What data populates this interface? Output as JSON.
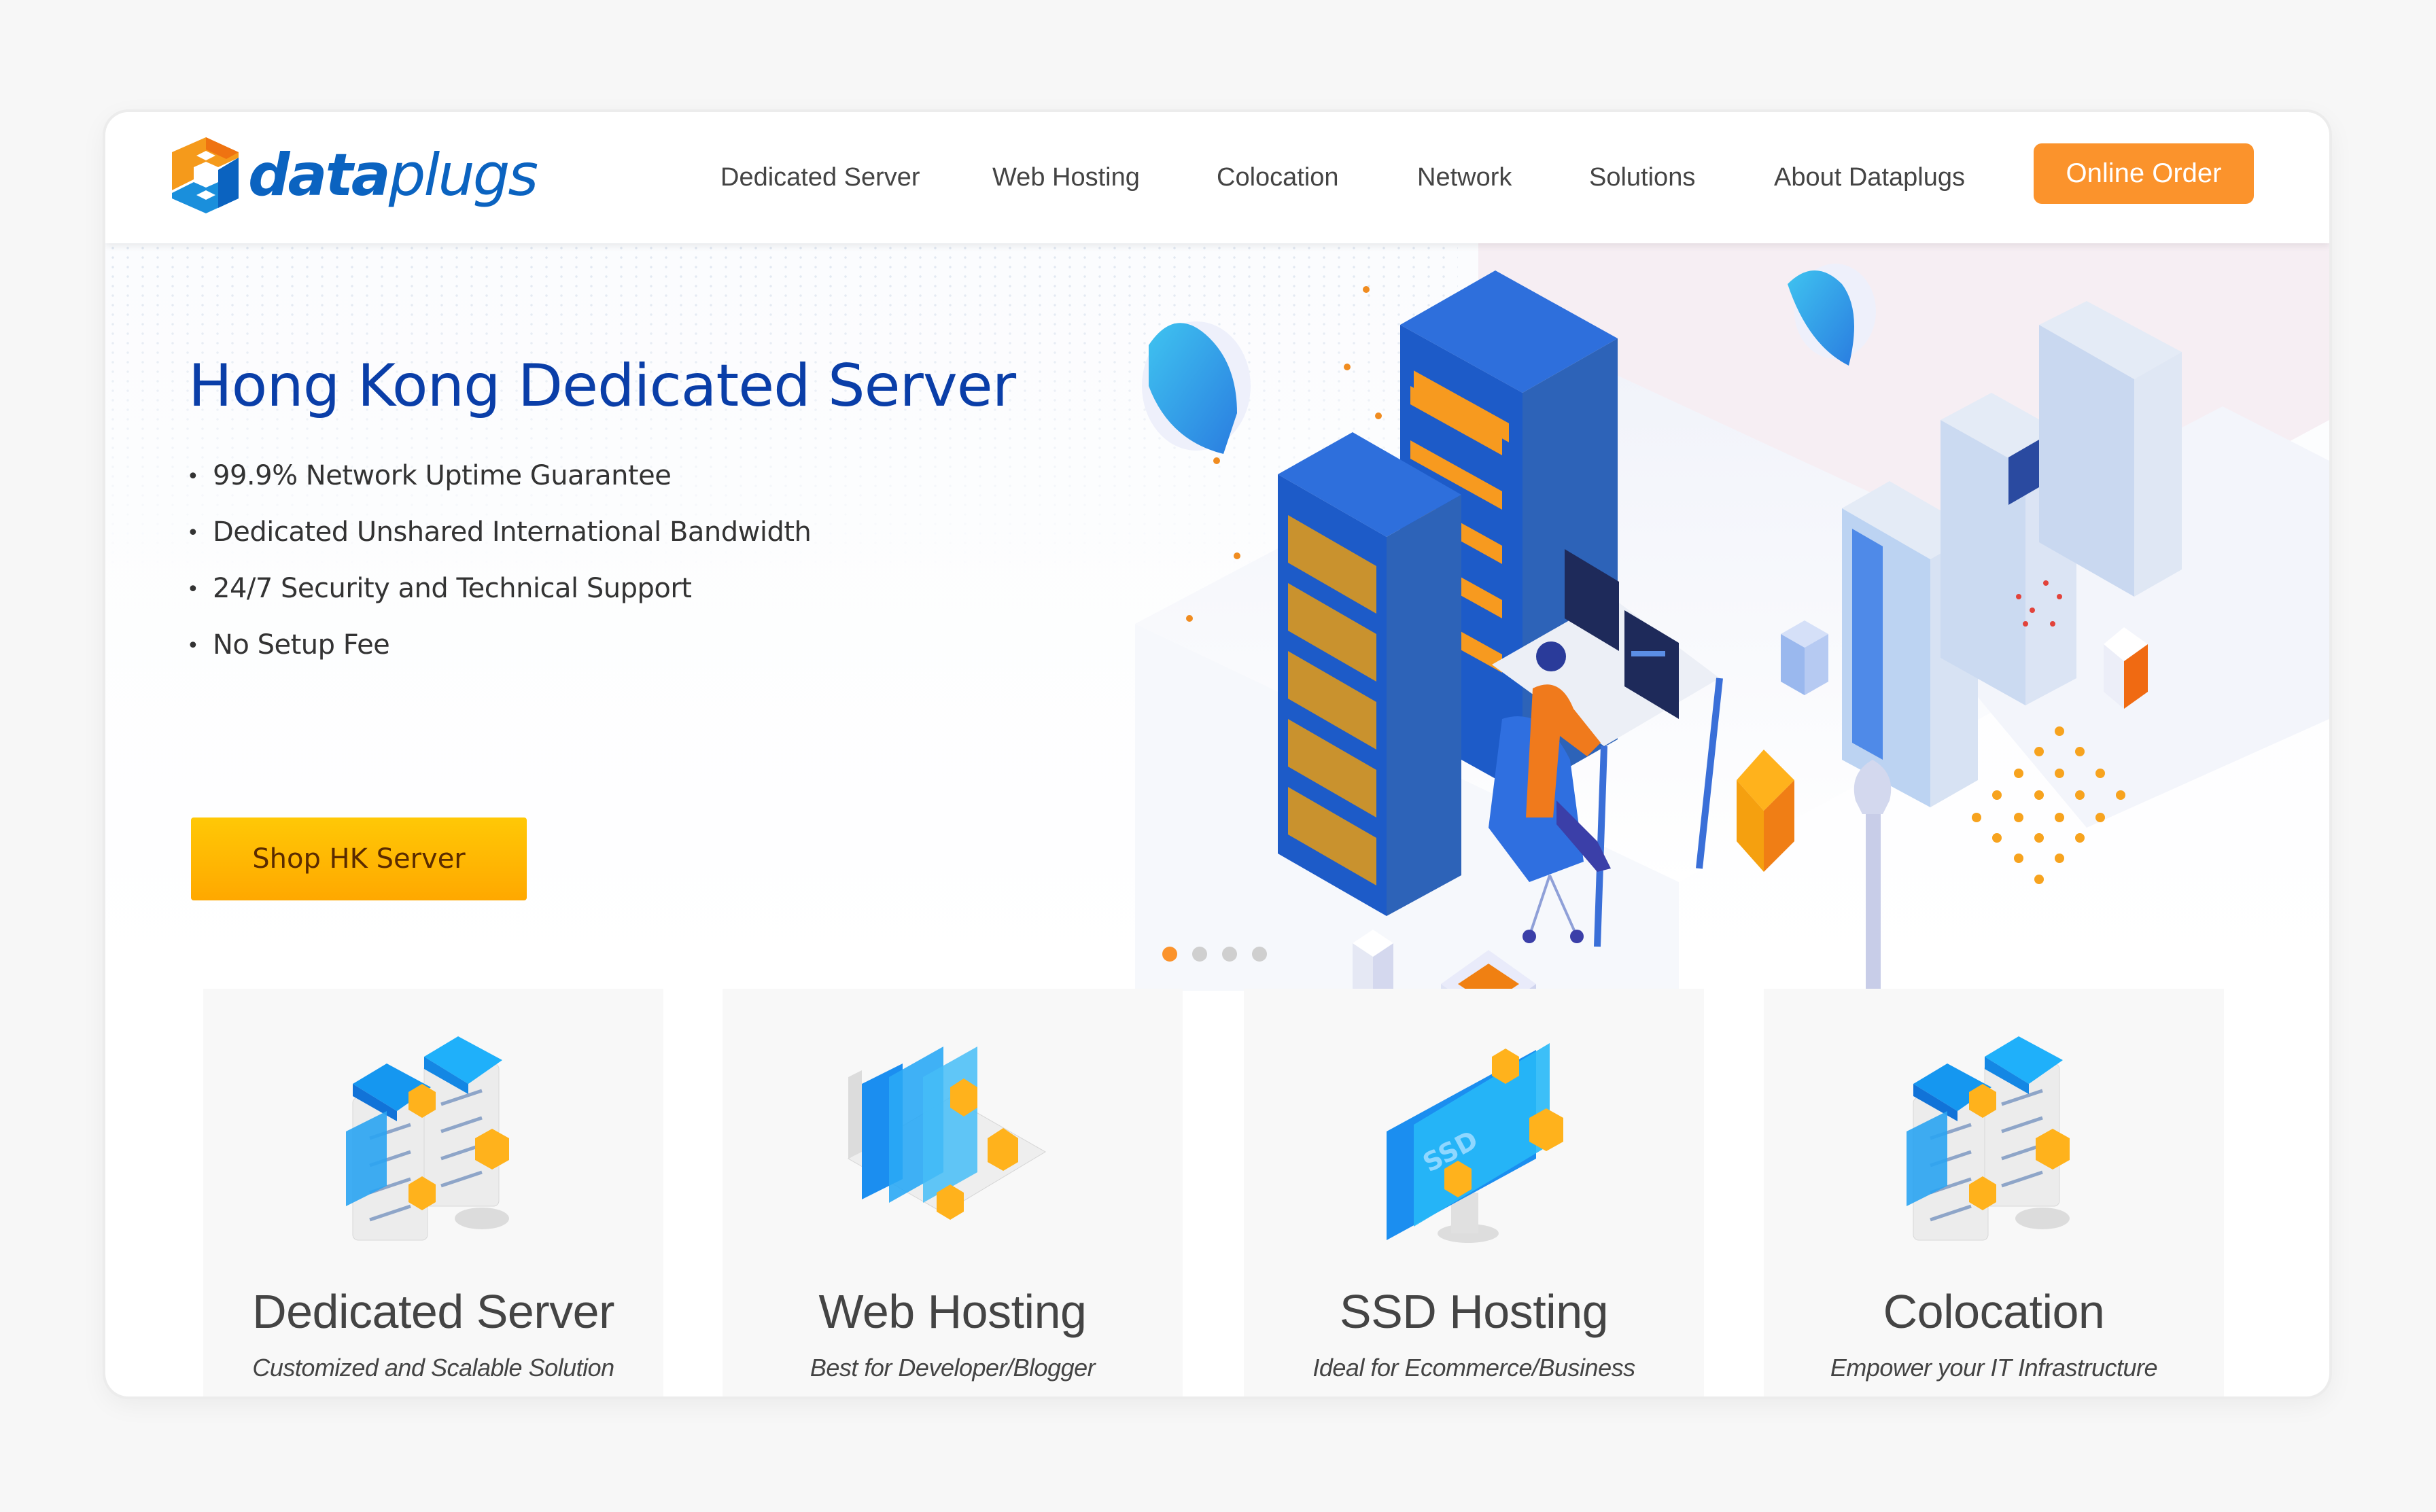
{
  "brand": {
    "name_bold": "data",
    "name_light": "plugs",
    "colors": {
      "orange": "#f59a1b",
      "blue": "#0b63c0",
      "accent": "#fb932c",
      "title_blue": "#0a3ea8"
    }
  },
  "nav": {
    "items": [
      {
        "label": "Dedicated Server"
      },
      {
        "label": "Web Hosting"
      },
      {
        "label": "Colocation"
      },
      {
        "label": "Network"
      },
      {
        "label": "Solutions"
      },
      {
        "label": "About Dataplugs"
      }
    ],
    "cta_label": "Online Order"
  },
  "hero": {
    "title": "Hong Kong Dedicated Server",
    "features": [
      "99.9% Network Uptime Guarantee",
      "Dedicated Unshared International Bandwidth",
      "24/7 Security and Technical Support",
      "No Setup Fee"
    ],
    "bullet": "•",
    "cta_label": "Shop HK Server",
    "illustration_icon": "isometric-datacenter-illustration",
    "carousel": {
      "total": 4,
      "active": 1
    }
  },
  "cards": [
    {
      "title": "Dedicated Server",
      "subtitle": "Customized and Scalable Solution",
      "icon": "server-stack-icon"
    },
    {
      "title": "Web Hosting",
      "subtitle": "Best for Developer/Blogger",
      "icon": "laptop-pages-icon"
    },
    {
      "title": "SSD Hosting",
      "subtitle": "Ideal for Ecommerce/Business",
      "icon": "ssd-monitor-icon",
      "icon_text": "SSD"
    },
    {
      "title": "Colocation",
      "subtitle": "Empower your IT Infrastructure",
      "icon": "server-stack-icon"
    }
  ]
}
